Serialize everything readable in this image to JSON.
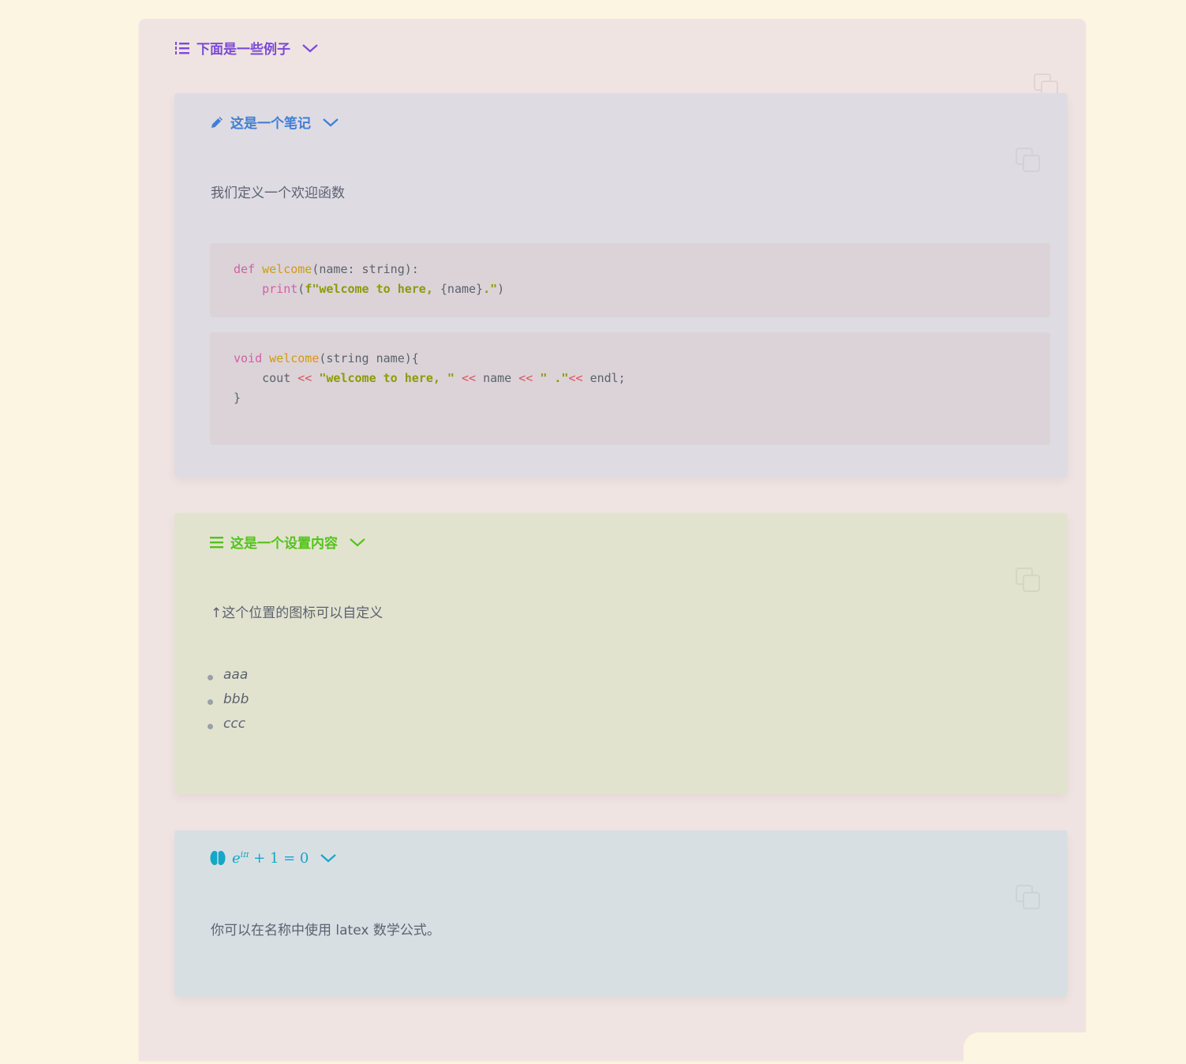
{
  "examples_header": {
    "title": "下面是一些例子",
    "icon": "list-ordered-icon",
    "color": "#7b4ad8"
  },
  "note_panel": {
    "title": "这是一个笔记",
    "icon": "pencil-icon",
    "color": "#3e7fd6",
    "text": "我们定义一个欢迎函数",
    "code_python": {
      "line1_kw": "def",
      "line1_fn": "welcome",
      "line1_rest": "(name: string):",
      "line2_fn": "print",
      "line2_open": "(",
      "line2_str": "f\"welcome to here, ",
      "line2_var": "{name}",
      "line2_str_end": ".\"",
      "line2_close": ")"
    },
    "code_cpp": {
      "line1_kw": "void",
      "line1_fn": "welcome",
      "line1_rest": "(string name){",
      "line2_a": "cout",
      "line2_op": "<<",
      "line2_str1": "\"welcome to here, \"",
      "line2_name": "name",
      "line2_str2": "\" .\"",
      "line2_endl": "endl;",
      "line3": "}"
    }
  },
  "settings_panel": {
    "title": "这是一个设置内容",
    "icon": "menu-icon",
    "color": "#52c41a",
    "text": "↑这个位置的图标可以自定义",
    "list": [
      "aaa",
      "bbb",
      "ccc"
    ]
  },
  "math_panel": {
    "icon": "brain-icon",
    "color": "#13a8c8",
    "formula_base": "e",
    "formula_sup": "iπ",
    "formula_rest": "+ 1 = 0",
    "text": "你可以在名称中使用 latex 数学公式。"
  }
}
